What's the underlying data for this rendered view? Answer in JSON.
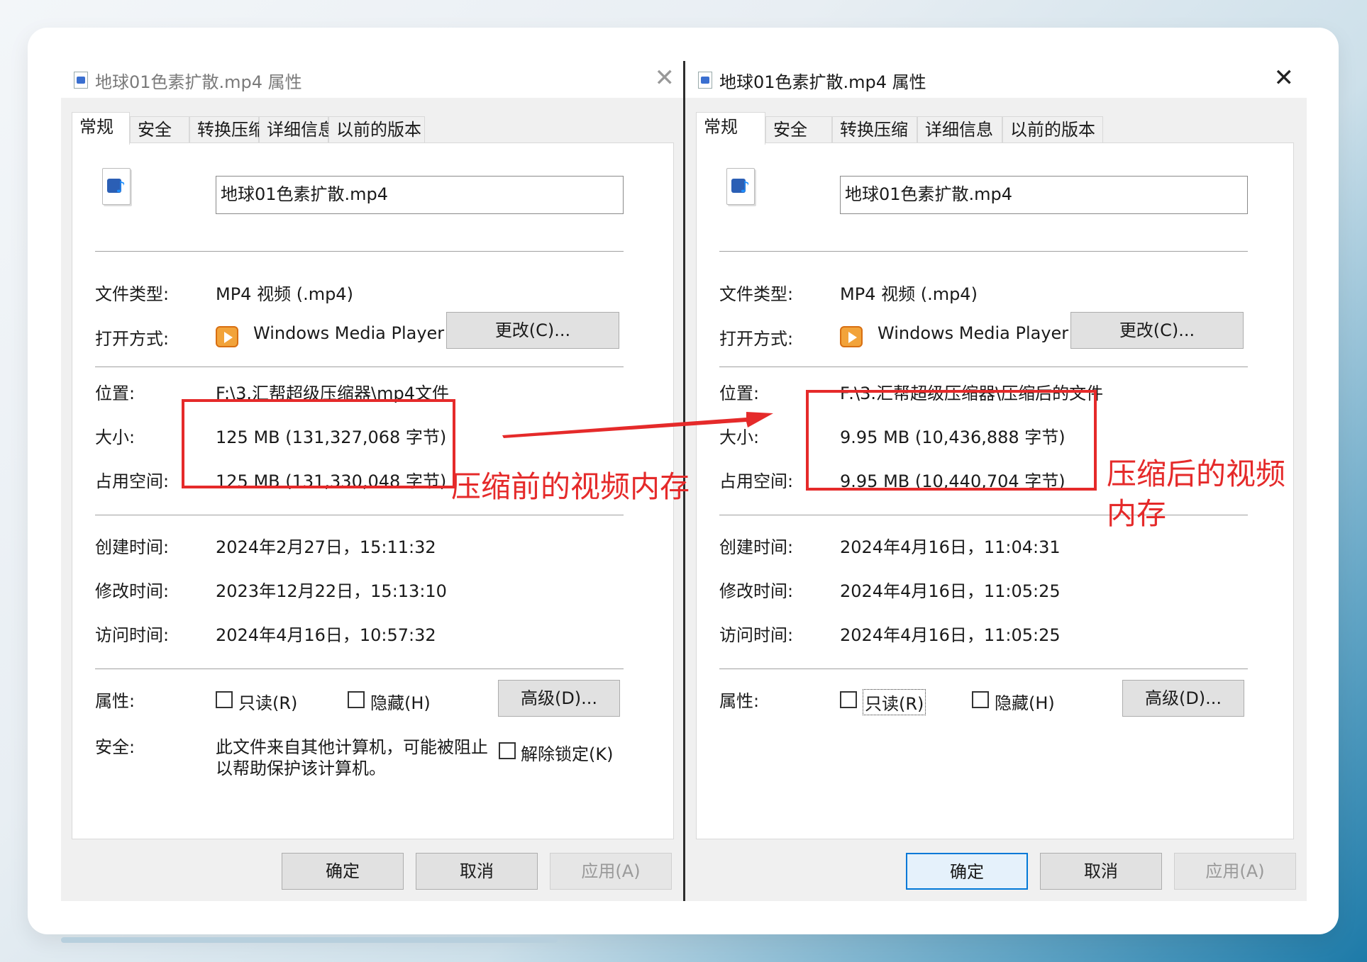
{
  "dialog_left": {
    "title": "地球01色素扩散.mp4 属性",
    "tabs": [
      "常规",
      "安全",
      "转换压缩",
      "详细信息",
      "以前的版本"
    ],
    "filename": "地球01色素扩散.mp4",
    "file_type_label": "文件类型:",
    "file_type_value": "MP4 视频 (.mp4)",
    "open_with_label": "打开方式:",
    "open_with_value": "Windows Media Player",
    "change_button": "更改(C)...",
    "location_label": "位置:",
    "location_value": "F:\\3.汇帮超级压缩器\\mp4文件",
    "size_label": "大小:",
    "size_value": "125 MB (131,327,068 字节)",
    "size_on_disk_label": "占用空间:",
    "size_on_disk_value": "125 MB (131,330,048 字节)",
    "created_label": "创建时间:",
    "created_value": "2024年2月27日，15:11:32",
    "modified_label": "修改时间:",
    "modified_value": "2023年12月22日，15:13:10",
    "accessed_label": "访问时间:",
    "accessed_value": "2024年4月16日，10:57:32",
    "attributes_label": "属性:",
    "readonly_label": "只读(R)",
    "hidden_label": "隐藏(H)",
    "advanced_button": "高级(D)...",
    "security_label": "安全:",
    "security_text_line1": "此文件来自其他计算机，可能被阻止",
    "security_text_line2": "以帮助保护该计算机。",
    "unblock_label": "解除锁定(K)",
    "ok_button": "确定",
    "cancel_button": "取消",
    "apply_button": "应用(A)"
  },
  "dialog_right": {
    "title": "地球01色素扩散.mp4 属性",
    "tabs": [
      "常规",
      "安全",
      "转换压缩",
      "详细信息",
      "以前的版本"
    ],
    "filename": "地球01色素扩散.mp4",
    "file_type_label": "文件类型:",
    "file_type_value": "MP4 视频 (.mp4)",
    "open_with_label": "打开方式:",
    "open_with_value": "Windows Media Player",
    "change_button": "更改(C)...",
    "location_label": "位置:",
    "location_value": "F:\\3.汇帮超级压缩器\\压缩后的文件",
    "size_label": "大小:",
    "size_value": "9.95 MB (10,436,888 字节)",
    "size_on_disk_label": "占用空间:",
    "size_on_disk_value": "9.95 MB (10,440,704 字节)",
    "created_label": "创建时间:",
    "created_value": "2024年4月16日，11:04:31",
    "modified_label": "修改时间:",
    "modified_value": "2024年4月16日，11:05:25",
    "accessed_label": "访问时间:",
    "accessed_value": "2024年4月16日，11:05:25",
    "attributes_label": "属性:",
    "readonly_label": "只读(R)",
    "hidden_label": "隐藏(H)",
    "advanced_button": "高级(D)...",
    "ok_button": "确定",
    "cancel_button": "取消",
    "apply_button": "应用(A)"
  },
  "annotations": {
    "before_label": "压缩前的视频内存",
    "after_label_line1": "压缩后的视频",
    "after_label_line2": "内存",
    "color": "#e52a2a"
  }
}
